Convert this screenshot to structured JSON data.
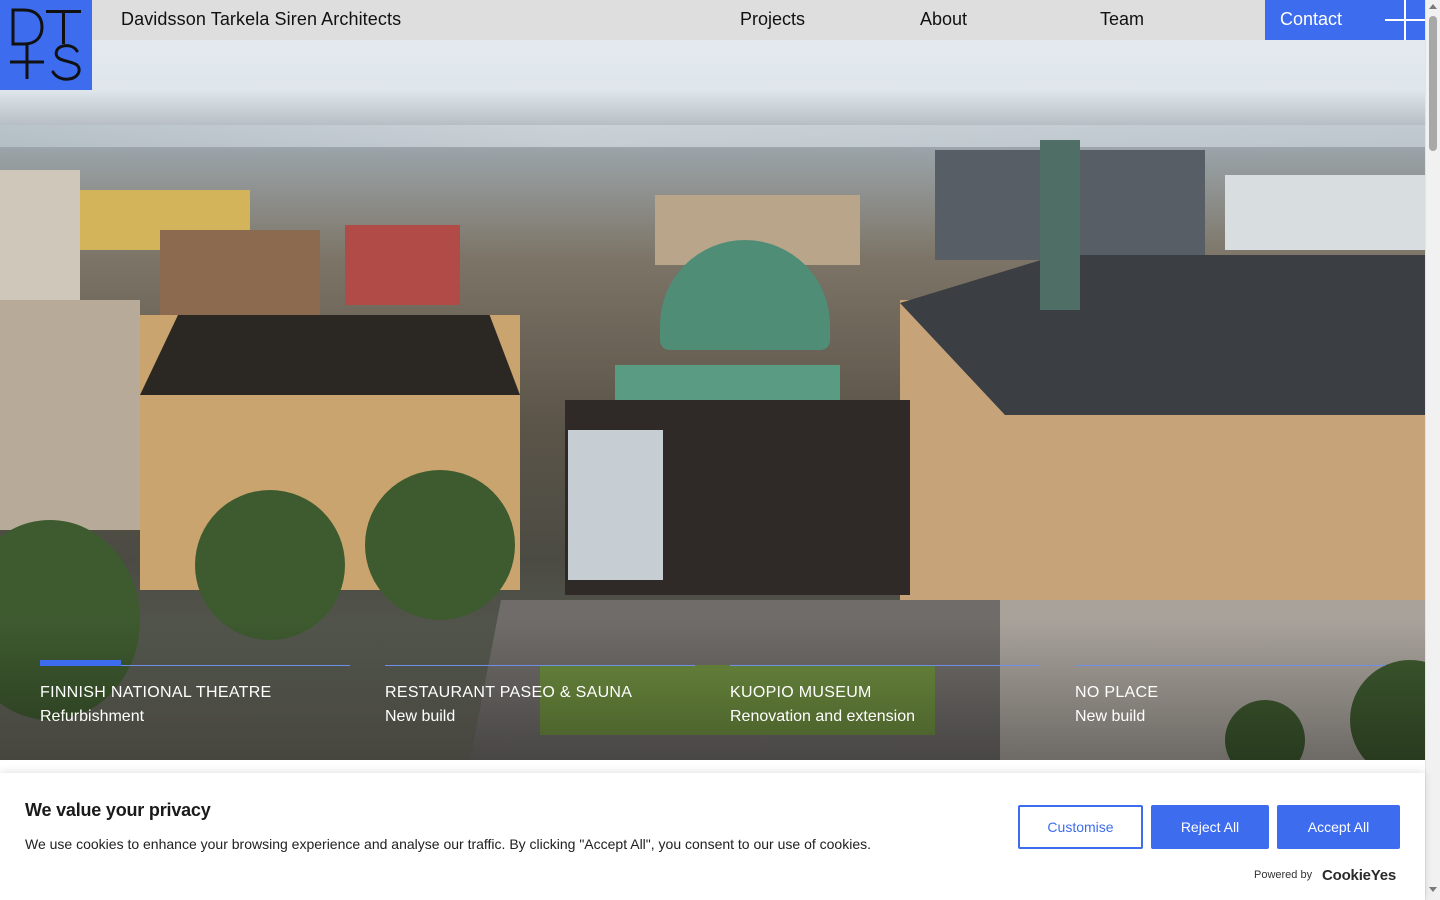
{
  "header": {
    "logo_text": "DT+S",
    "firm_name": "Davidsson Tarkela Siren Architects",
    "nav": {
      "projects": "Projects",
      "about": "About",
      "team": "Team",
      "contact": "Contact"
    }
  },
  "hero": {
    "projects": [
      {
        "title": "FINNISH NATIONAL THEATRE",
        "subtitle": "Refurbishment",
        "progress": 0.26,
        "active": true
      },
      {
        "title": "RESTAURANT PASEO & SAUNA",
        "subtitle": "New build",
        "progress": 0,
        "active": false
      },
      {
        "title": "KUOPIO MUSEUM",
        "subtitle": "Renovation and extension",
        "progress": 0,
        "active": false
      },
      {
        "title": "NO PLACE",
        "subtitle": "New build",
        "progress": 0,
        "active": false
      }
    ]
  },
  "cookie_banner": {
    "heading": "We value your privacy",
    "text": "We use cookies to enhance your browsing experience and analyse our traffic. By clicking \"Accept All\", you consent to our use of cookies.",
    "customise": "Customise",
    "reject_all": "Reject All",
    "accept_all": "Accept All",
    "powered_by": "Powered by",
    "brand": "CookieYes"
  },
  "colors": {
    "accent": "#3d6cef",
    "header_bg": "#dedede",
    "text": "#111111"
  },
  "icons": {
    "logo": "dts-logo-icon",
    "contact_plus": "plus-icon"
  }
}
